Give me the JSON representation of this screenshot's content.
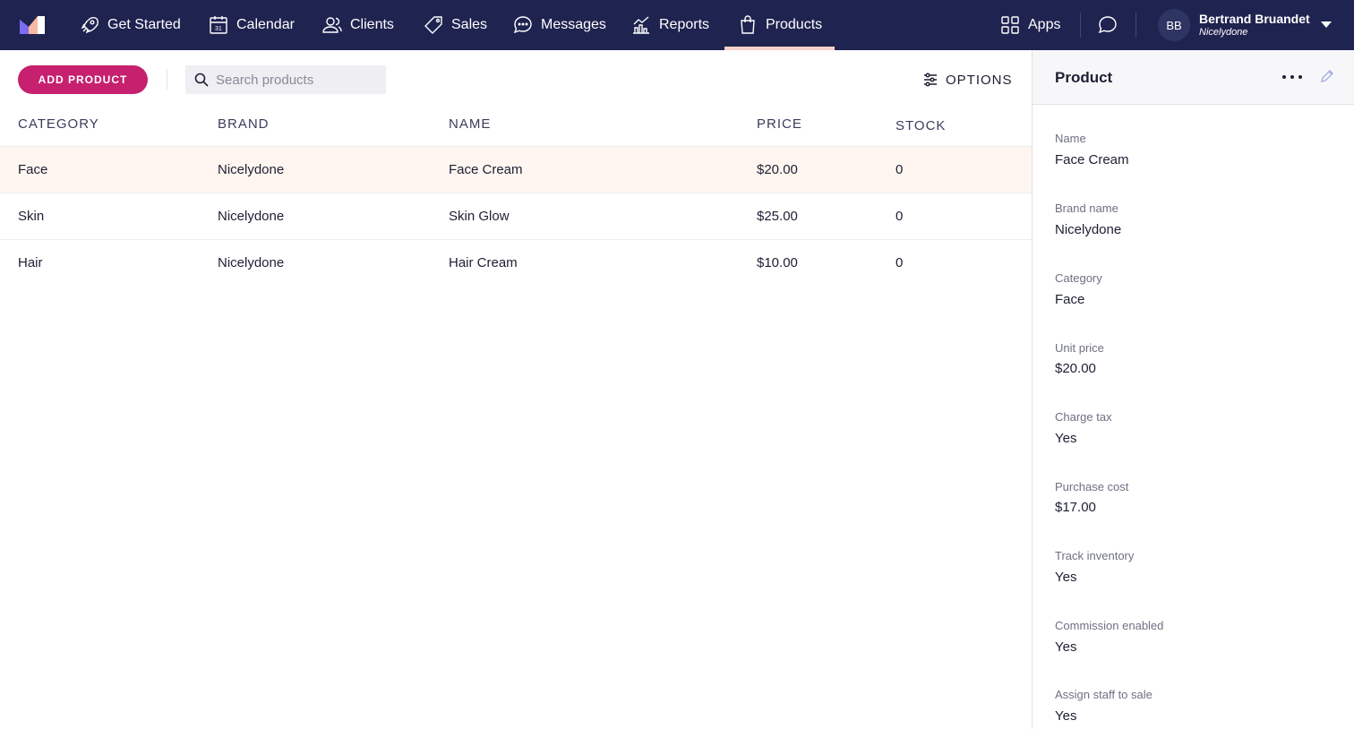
{
  "nav": {
    "items": [
      {
        "label": "Get Started",
        "icon": "rocket-icon"
      },
      {
        "label": "Calendar",
        "icon": "calendar-icon"
      },
      {
        "label": "Clients",
        "icon": "clients-icon"
      },
      {
        "label": "Sales",
        "icon": "tag-icon"
      },
      {
        "label": "Messages",
        "icon": "chat-bubble-icon"
      },
      {
        "label": "Reports",
        "icon": "bar-chart-icon"
      },
      {
        "label": "Products",
        "icon": "shopping-bag-icon"
      }
    ],
    "active": "Products",
    "apps_label": "Apps",
    "user": {
      "initials": "BB",
      "name": "Bertrand Bruandet",
      "business": "Nicelydone"
    },
    "colors": {
      "background": "#1f2350",
      "active_underline": "#f7d3c7"
    }
  },
  "toolbar": {
    "add_label": "ADD PRODUCT",
    "search_placeholder": "Search products",
    "options_label": "OPTIONS",
    "accent": "#c6206e"
  },
  "table": {
    "headers": {
      "category": "CATEGORY",
      "brand": "BRAND",
      "name": "NAME",
      "price": "PRICE",
      "stock": "STOCK"
    },
    "rows": [
      {
        "category": "Face",
        "brand": "Nicelydone",
        "name": "Face Cream",
        "price": "$20.00",
        "stock": "0",
        "selected": true
      },
      {
        "category": "Skin",
        "brand": "Nicelydone",
        "name": "Skin Glow",
        "price": "$25.00",
        "stock": "0",
        "selected": false
      },
      {
        "category": "Hair",
        "brand": "Nicelydone",
        "name": "Hair Cream",
        "price": "$10.00",
        "stock": "0",
        "selected": false
      }
    ]
  },
  "panel": {
    "title": "Product",
    "fields": [
      {
        "label": "Name",
        "value": "Face Cream"
      },
      {
        "label": "Brand name",
        "value": "Nicelydone"
      },
      {
        "label": "Category",
        "value": "Face"
      },
      {
        "label": "Unit price",
        "value": "$20.00"
      },
      {
        "label": "Charge tax",
        "value": "Yes"
      },
      {
        "label": "Purchase cost",
        "value": "$17.00"
      },
      {
        "label": "Track inventory",
        "value": "Yes"
      },
      {
        "label": "Commission enabled",
        "value": "Yes"
      },
      {
        "label": "Assign staff to sale",
        "value": "Yes"
      }
    ]
  }
}
